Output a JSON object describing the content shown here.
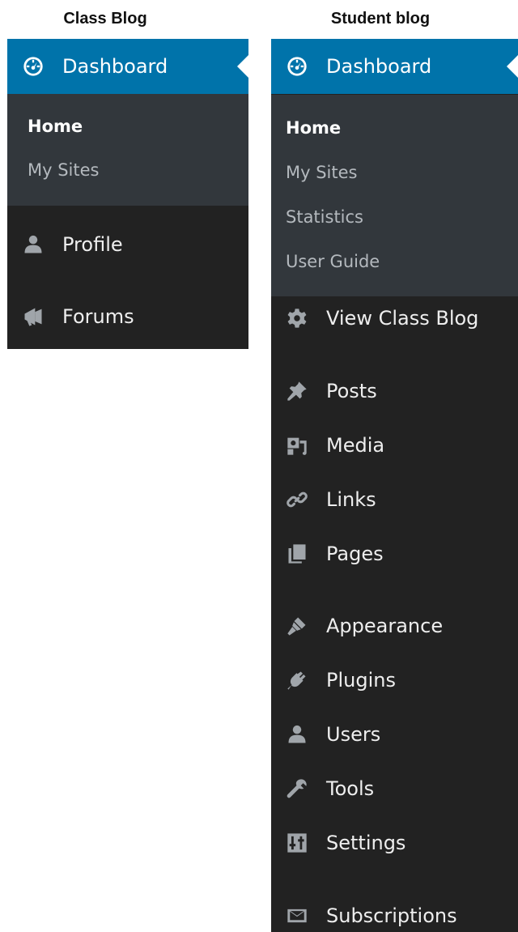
{
  "class_blog": {
    "title": "Class Blog",
    "dashboard": "Dashboard",
    "submenu": [
      "Home",
      "My Sites"
    ],
    "menu": [
      "Profile",
      "Forums"
    ]
  },
  "student_blog": {
    "title": "Student blog",
    "dashboard": "Dashboard",
    "submenu": [
      "Home",
      "My Sites",
      "Statistics",
      "User Guide"
    ],
    "menu": [
      "View Class Blog",
      "Posts",
      "Media",
      "Links",
      "Pages",
      "Appearance",
      "Plugins",
      "Users",
      "Tools",
      "Settings",
      "Subscriptions"
    ]
  },
  "colors": {
    "menu_bg": "#222222",
    "submenu_bg": "#32373c",
    "active_bg": "#0073aa",
    "icon": "#a0a5aa",
    "text": "#eeeeee"
  },
  "icons": {
    "dashboard": "dashboard-gauge-icon",
    "profile": "user-icon",
    "forums": "megaphone-icon",
    "view_class_blog": "gear-icon",
    "posts": "pushpin-icon",
    "media": "media-icon",
    "links": "link-icon",
    "pages": "pages-icon",
    "appearance": "paintbrush-icon",
    "plugins": "plugin-icon",
    "users": "user-icon",
    "tools": "wrench-icon",
    "settings": "settings-sliders-icon",
    "subscriptions": "envelope-icon"
  }
}
